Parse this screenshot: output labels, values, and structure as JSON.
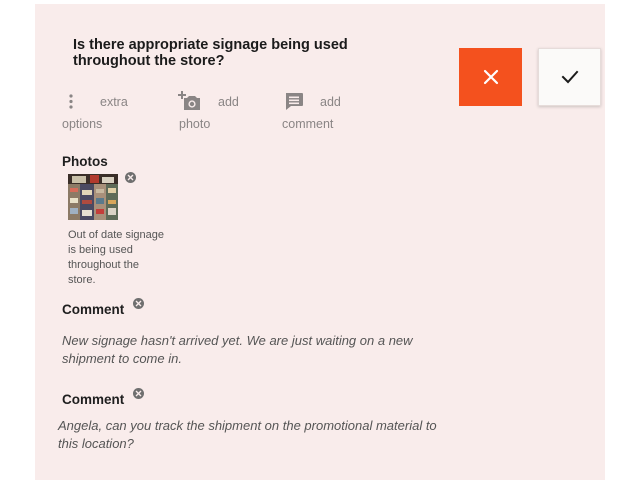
{
  "question": "Is there appropriate signage being used throughout the store?",
  "actions": {
    "options": {
      "line1": "extra",
      "line2": "options",
      "icon": "more-vert-icon"
    },
    "photo": {
      "line1": "add",
      "line2": "photo",
      "icon": "add-photo-icon"
    },
    "comment": {
      "line1": "add",
      "line2": "comment",
      "icon": "comment-icon"
    }
  },
  "buttons": {
    "reject_icon": "close-icon",
    "accept_icon": "check-icon"
  },
  "photos": {
    "title": "Photos",
    "items": [
      {
        "caption": "Out of date signage is being used throughout the store."
      }
    ]
  },
  "comments": [
    {
      "title": "Comment",
      "text": "New signage hasn't arrived yet. We are just waiting on a new shipment to come in."
    },
    {
      "title": "Comment",
      "text": "Angela, can you track the shipment on the promotional material to this location?"
    }
  ],
  "colors": {
    "background": "#f9eceb",
    "reject": "#f4511e",
    "accept": "#fbfaf9"
  }
}
